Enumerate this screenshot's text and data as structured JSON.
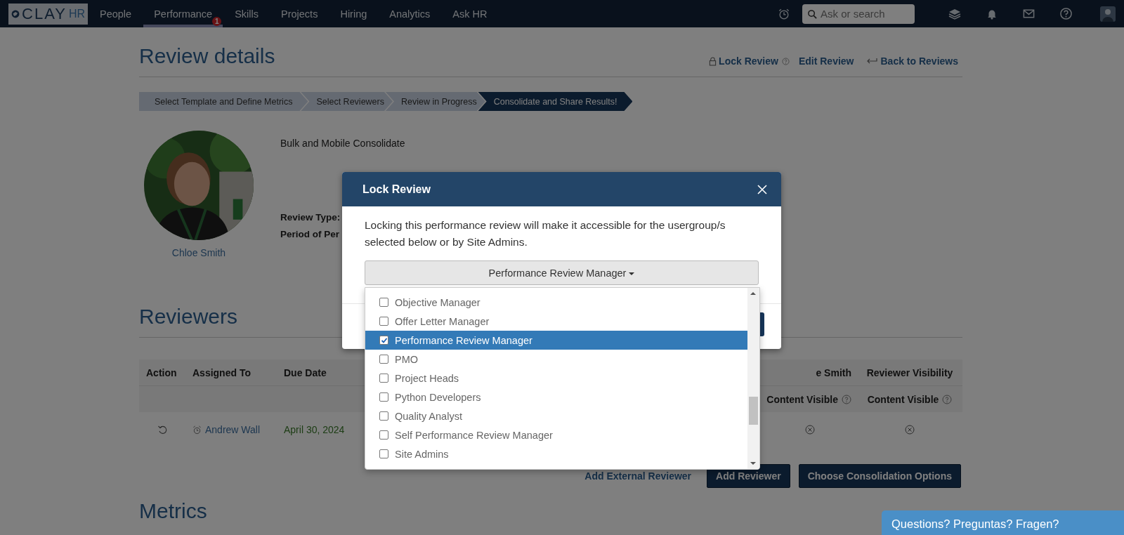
{
  "nav": {
    "logo": {
      "main": "CLAY",
      "sub": "HR"
    },
    "items": [
      {
        "label": "People",
        "selected": false
      },
      {
        "label": "Performance",
        "selected": true,
        "badge": "1"
      },
      {
        "label": "Skills",
        "selected": false
      },
      {
        "label": "Projects",
        "selected": false
      },
      {
        "label": "Hiring",
        "selected": false
      },
      {
        "label": "Analytics",
        "selected": false
      },
      {
        "label": "Ask HR",
        "selected": false
      }
    ],
    "search": {
      "placeholder": "Ask or search"
    }
  },
  "page": {
    "title": "Review details",
    "actions": [
      {
        "kind": "lock",
        "label": "Lock Review"
      },
      {
        "kind": "edit",
        "label": "Edit Review"
      },
      {
        "kind": "back",
        "label": "Back to Reviews"
      }
    ],
    "steps": [
      {
        "label": "Select Template and Define Metrics",
        "selected": false
      },
      {
        "label": "Select Reviewers",
        "selected": false
      },
      {
        "label": "Review in Progress",
        "selected": false
      },
      {
        "label": "Consolidate and Share Results!",
        "selected": true
      }
    ],
    "employee": {
      "name": "Chloe Smith"
    },
    "review_name": "Bulk and Mobile Consolidate",
    "fields": [
      "Review Type:",
      "Period of Per"
    ]
  },
  "reviewers": {
    "title": "Reviewers",
    "columns": [
      "Action",
      "Assigned To",
      "Due Date",
      "e Smith",
      "Reviewer Visibility"
    ],
    "subheaders": [
      "Content Visible",
      "Content Visible"
    ],
    "rows": [
      {
        "assignee": "Andrew Wall",
        "due": "April 30, 2024"
      }
    ],
    "buttons": [
      {
        "kind": "link",
        "label": "Add External Reviewer"
      },
      {
        "kind": "primary",
        "label": "Add Reviewer"
      },
      {
        "kind": "primary",
        "label": "Choose Consolidation Options"
      }
    ]
  },
  "metrics": {
    "title": "Metrics"
  },
  "chat": {
    "label": "Questions? Preguntas? Fragen?"
  },
  "modal": {
    "title": "Lock Review",
    "message": "Locking this performance review will make it accessible for the usergroup/s selected below or by Site Admins.",
    "dropdown": {
      "value": "Performance Review Manager",
      "options": [
        {
          "label": "Objective Manager",
          "checked": false,
          "selected": false
        },
        {
          "label": "Offer Letter Manager",
          "checked": false,
          "selected": false
        },
        {
          "label": "Performance Review Manager",
          "checked": true,
          "selected": true
        },
        {
          "label": "PMO",
          "checked": false,
          "selected": false
        },
        {
          "label": "Project Heads",
          "checked": false,
          "selected": false
        },
        {
          "label": "Python Developers",
          "checked": false,
          "selected": false
        },
        {
          "label": "Quality Analyst",
          "checked": false,
          "selected": false
        },
        {
          "label": "Self Performance Review Manager",
          "checked": false,
          "selected": false
        },
        {
          "label": "Site Admins",
          "checked": false,
          "selected": false
        }
      ]
    }
  }
}
